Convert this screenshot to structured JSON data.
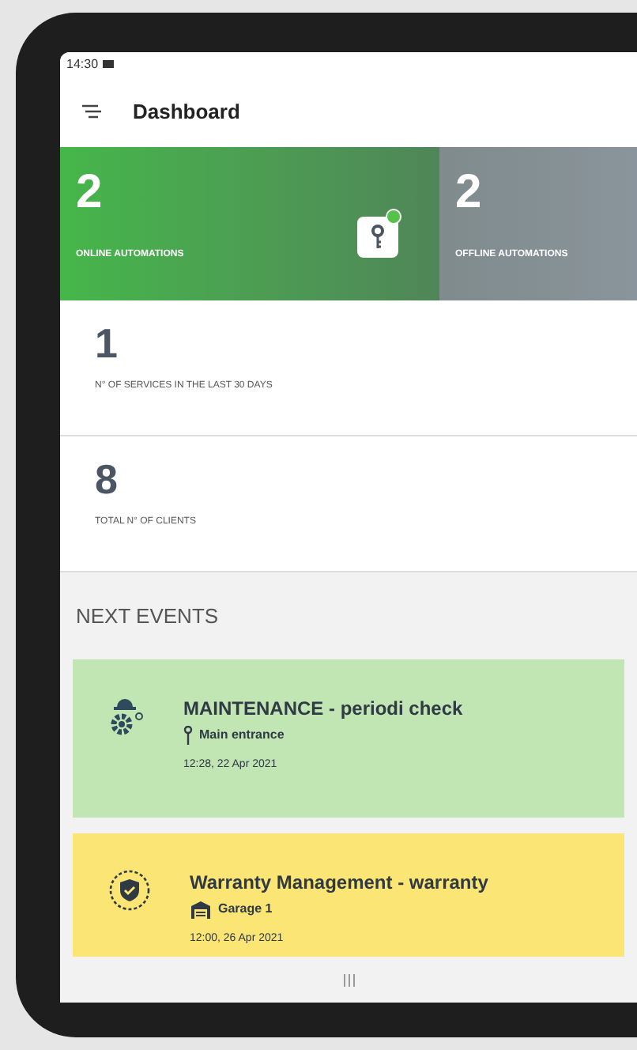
{
  "status_bar": {
    "time": "14:30"
  },
  "header": {
    "title": "Dashboard"
  },
  "automation_tiles": [
    {
      "kind": "online",
      "count": "2",
      "label": "ONLINE AUTOMATIONS"
    },
    {
      "kind": "offline",
      "count": "2",
      "label": "OFFLINE AUTOMATIONS"
    }
  ],
  "stat_cards": [
    {
      "count": "1",
      "label": "N° OF SERVICES IN THE LAST 30 DAYS"
    },
    {
      "count": "8",
      "label": "TOTAL N° OF CLIENTS"
    }
  ],
  "next_events": {
    "heading": "NEXT EVENTS",
    "events": [
      {
        "kind": "maintenance",
        "title": "MAINTENANCE - periodi check",
        "location": {
          "kind": "door",
          "name": "Main entrance"
        },
        "time": "12:28, 22 Apr 2021"
      },
      {
        "kind": "warranty",
        "title": "Warranty Management - warranty",
        "location": {
          "kind": "garage",
          "name": "Garage 1"
        },
        "time": "12:00, 26 Apr 2021"
      }
    ]
  }
}
